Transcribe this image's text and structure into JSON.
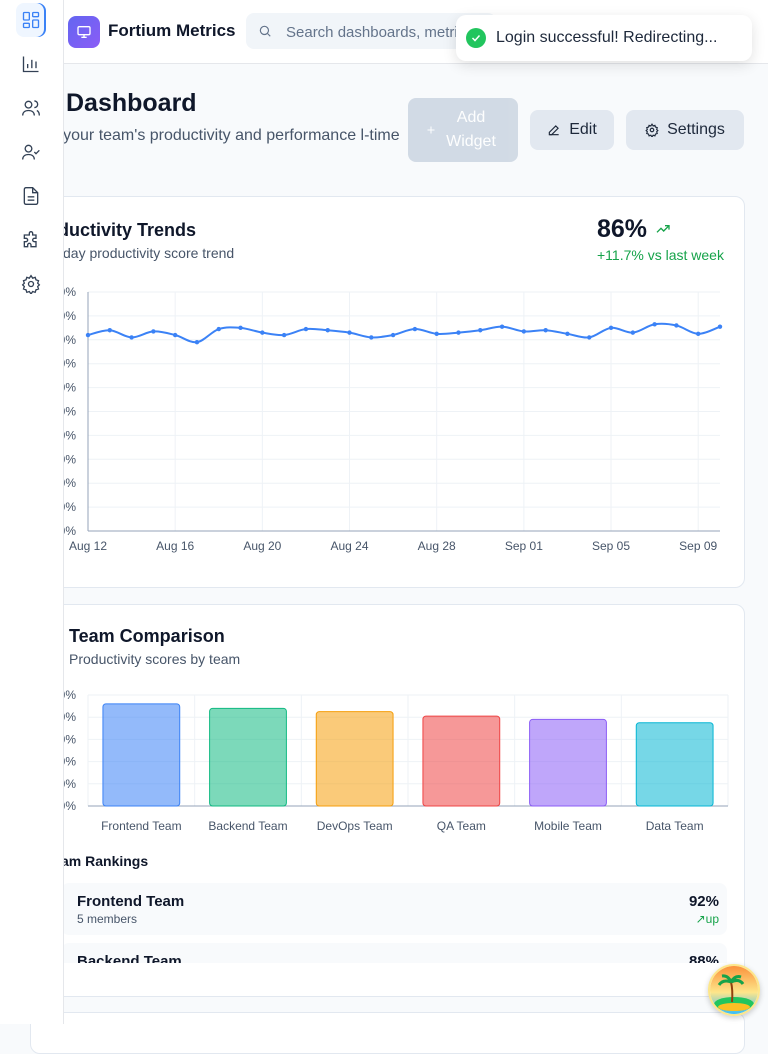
{
  "header": {
    "brand": "Fortium Metrics",
    "search_placeholder": "Search dashboards, metrics..."
  },
  "sidebar": {
    "items": [
      {
        "icon": "dashboard-icon",
        "active": true
      },
      {
        "icon": "bar-chart-icon",
        "active": false
      },
      {
        "icon": "users-icon",
        "active": false
      },
      {
        "icon": "user-check-icon",
        "active": false
      },
      {
        "icon": "document-icon",
        "active": false
      },
      {
        "icon": "puzzle-icon",
        "active": false
      },
      {
        "icon": "gear-icon",
        "active": false
      }
    ]
  },
  "toast": {
    "message": "Login successful! Redirecting..."
  },
  "page": {
    "title": "Dashboard",
    "subtitle": "tor your team's productivity and performance l-time",
    "add_widget_label": "Add Widget",
    "edit_label": "Edit",
    "settings_label": "Settings"
  },
  "productivity": {
    "title": "oductivity Trends",
    "subtitle": "day productivity score trend",
    "metric": "86%",
    "change": "+11.7% vs last week"
  },
  "team_comparison": {
    "title": "Team Comparison",
    "subtitle": "Productivity scores by team",
    "rankings_title": "am Rankings",
    "rankings": [
      {
        "name": "Frontend Team",
        "members": "5 members",
        "score": "92%",
        "trend": "↗up"
      },
      {
        "name": "Backend Team",
        "members": "",
        "score": "88%",
        "trend": ""
      }
    ]
  },
  "chart_data": [
    {
      "type": "line",
      "title": "oductivity Trends",
      "x_tick_labels": [
        "Aug 12",
        "Aug 16",
        "Aug 20",
        "Aug 24",
        "Aug 28",
        "Sep 01",
        "Sep 05",
        "Sep 09"
      ],
      "x": [
        "Aug 12",
        "Aug 13",
        "Aug 14",
        "Aug 15",
        "Aug 16",
        "Aug 17",
        "Aug 18",
        "Aug 19",
        "Aug 20",
        "Aug 21",
        "Aug 22",
        "Aug 23",
        "Aug 24",
        "Aug 25",
        "Aug 26",
        "Aug 27",
        "Aug 28",
        "Aug 29",
        "Aug 30",
        "Aug 31",
        "Sep 01",
        "Sep 02",
        "Sep 03",
        "Sep 04",
        "Sep 05",
        "Sep 06",
        "Sep 07",
        "Sep 08",
        "Sep 09",
        "Sep 10"
      ],
      "values": [
        82,
        84,
        81,
        83.5,
        82,
        79,
        84.5,
        85,
        83,
        82,
        84.5,
        84,
        83,
        81,
        82,
        84.5,
        82.5,
        83,
        84,
        85.5,
        83.5,
        84,
        82.5,
        81,
        85,
        83,
        86.5,
        86,
        82.5,
        85.5
      ],
      "ylim": [
        0,
        100
      ],
      "grid": true,
      "color": "#3b82f6"
    },
    {
      "type": "bar",
      "title": "Team Comparison",
      "categories": [
        "Frontend Team",
        "Backend Team",
        "DevOps Team",
        "QA Team",
        "Mobile Team",
        "Data Team"
      ],
      "values": [
        92,
        88,
        85,
        81,
        78,
        75
      ],
      "ylim": [
        0,
        100
      ],
      "colors": [
        "#3b82f6",
        "#10b981",
        "#f59e0b",
        "#ef4444",
        "#8b5cf6",
        "#06b6d4"
      ]
    }
  ]
}
